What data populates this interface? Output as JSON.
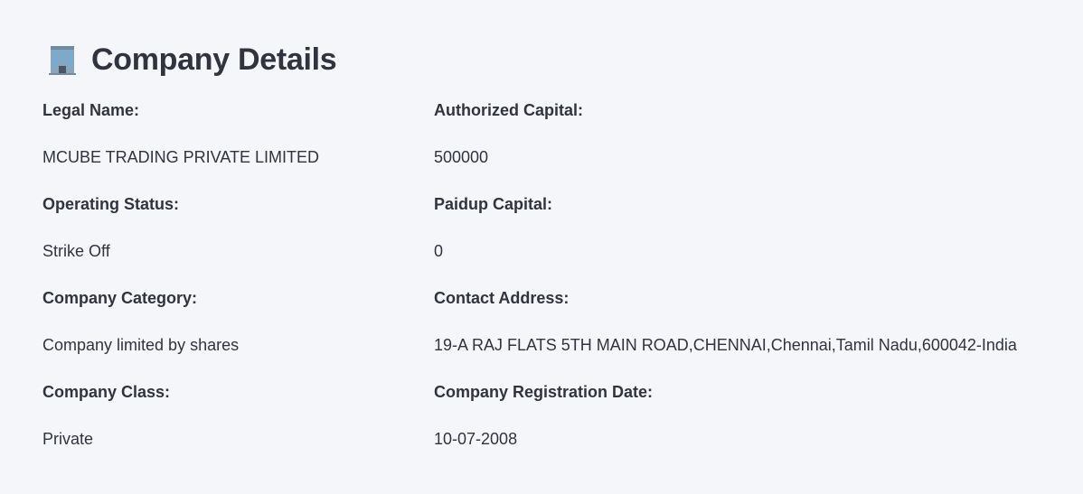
{
  "header": {
    "title": "Company Details",
    "icon": "office-building-icon"
  },
  "details": {
    "legal_name_label": "Legal Name:",
    "legal_name_value": "MCUBE TRADING PRIVATE LIMITED",
    "authorized_capital_label": "Authorized Capital:",
    "authorized_capital_value": "500000",
    "operating_status_label": "Operating Status:",
    "operating_status_value": "Strike Off",
    "paidup_capital_label": "Paidup Capital:",
    "paidup_capital_value": "0",
    "company_category_label": "Company Category:",
    "company_category_value": "Company limited by shares",
    "contact_address_label": "Contact Address:",
    "contact_address_value": "19-A RAJ FLATS 5TH MAIN ROAD,CHENNAI,Chennai,Tamil Nadu,600042-India",
    "company_class_label": "Company Class:",
    "company_class_value": "Private",
    "registration_date_label": "Company Registration Date:",
    "registration_date_value": "10-07-2008"
  },
  "colors": {
    "background": "#f5f6fa",
    "text": "#31333f"
  }
}
